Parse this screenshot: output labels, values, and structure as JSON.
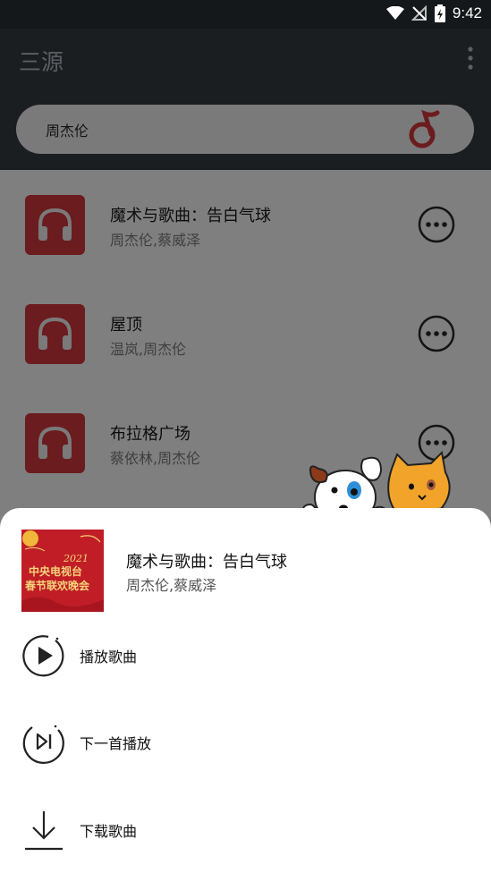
{
  "status": {
    "time": "9:42"
  },
  "app": {
    "title": "三源"
  },
  "search": {
    "value": "周杰伦"
  },
  "songs": [
    {
      "title": "魔术与歌曲：告白气球",
      "artist": "周杰伦,蔡威泽"
    },
    {
      "title": "屋顶",
      "artist": "温岚,周杰伦"
    },
    {
      "title": "布拉格广场",
      "artist": "蔡依林,周杰伦"
    }
  ],
  "sheet": {
    "title": "魔术与歌曲：告白气球",
    "artist": "周杰伦,蔡威泽",
    "cover_year": "2021",
    "cover_line1": "中央电视台",
    "cover_line2": "春节联欢晚会",
    "actions": [
      {
        "label": "播放歌曲",
        "icon": "play-circle-icon"
      },
      {
        "label": "下一首播放",
        "icon": "next-circle-icon"
      },
      {
        "label": "下载歌曲",
        "icon": "download-icon"
      }
    ]
  },
  "colors": {
    "accent": "#d32f3a",
    "appbar": "#1a1e21",
    "scrim": "#7f7f7f"
  }
}
